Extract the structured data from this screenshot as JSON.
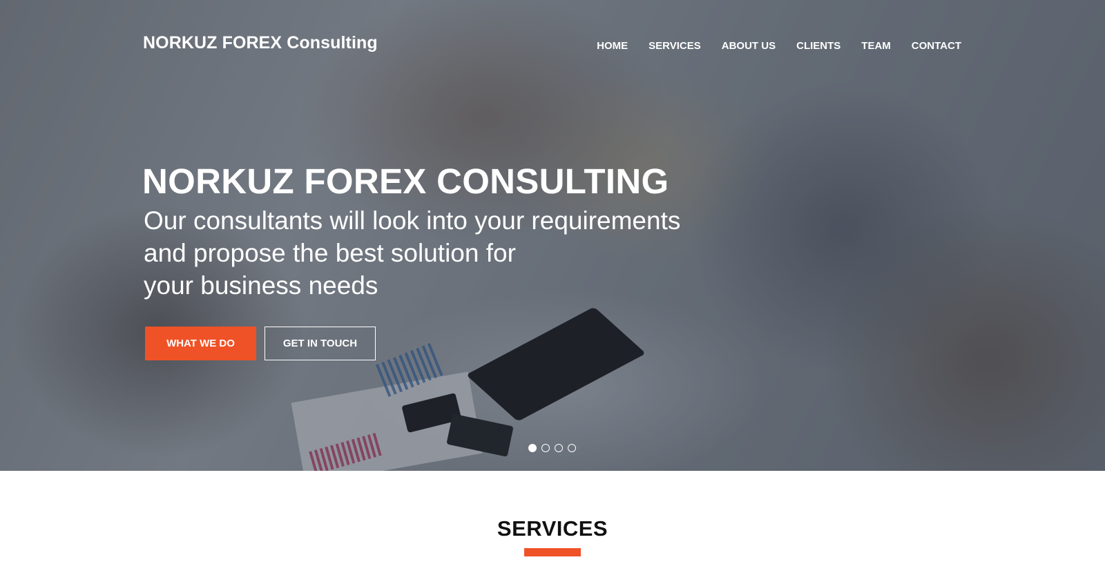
{
  "brand": {
    "name": "NORKUZ FOREX Consulting"
  },
  "nav": {
    "items": [
      {
        "label": "HOME"
      },
      {
        "label": "SERVICES"
      },
      {
        "label": "ABOUT US"
      },
      {
        "label": "CLIENTS"
      },
      {
        "label": "TEAM"
      },
      {
        "label": "CONTACT"
      }
    ]
  },
  "hero": {
    "title": "NORKUZ FOREX CONSULTING",
    "lines": [
      "Our consultants will look into your requirements",
      "and propose the best solution for",
      "your business needs"
    ],
    "primary_button": "WHAT WE DO",
    "secondary_button": "GET IN TOUCH",
    "slides": {
      "count": 4,
      "active": 1
    }
  },
  "services": {
    "title": "SERVICES"
  },
  "colors": {
    "accent": "#ef5227",
    "text_light": "#ffffff",
    "text_dark": "#111111"
  }
}
